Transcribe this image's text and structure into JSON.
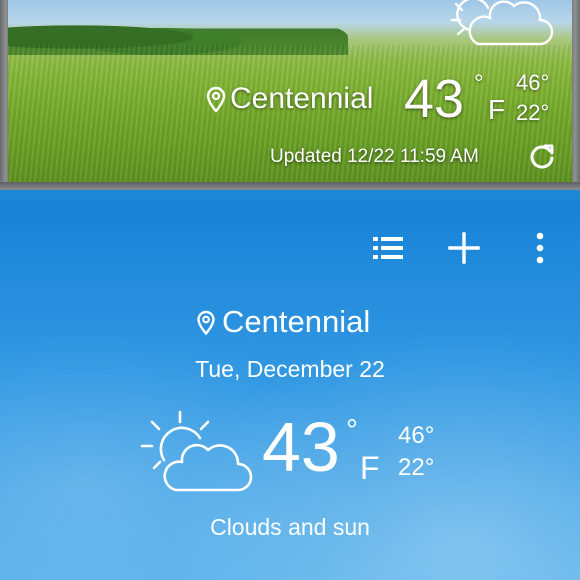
{
  "widget": {
    "city": "Centennial",
    "temperature": "43",
    "degree_symbol": "°",
    "unit": "F",
    "high": "46°",
    "low": "22°",
    "updated": "Updated 12/22 11:59 AM",
    "weather_icon": "partly-cloudy-icon",
    "location_icon": "location-pin-icon",
    "refresh_icon": "refresh-icon"
  },
  "app": {
    "actions": [
      {
        "name": "list-icon"
      },
      {
        "name": "add-icon"
      },
      {
        "name": "more-options-icon"
      }
    ],
    "city": "Centennial",
    "date": "Tue, December 22",
    "temperature": "43",
    "degree_symbol": "°",
    "unit": "F",
    "high": "46°",
    "low": "22°",
    "condition": "Clouds and sun",
    "weather_icon": "partly-cloudy-icon",
    "location_icon": "location-pin-icon"
  },
  "colors": {
    "sky_top": "#1a82d6",
    "sky_bottom": "#56b0ea",
    "text": "#ffffff"
  }
}
